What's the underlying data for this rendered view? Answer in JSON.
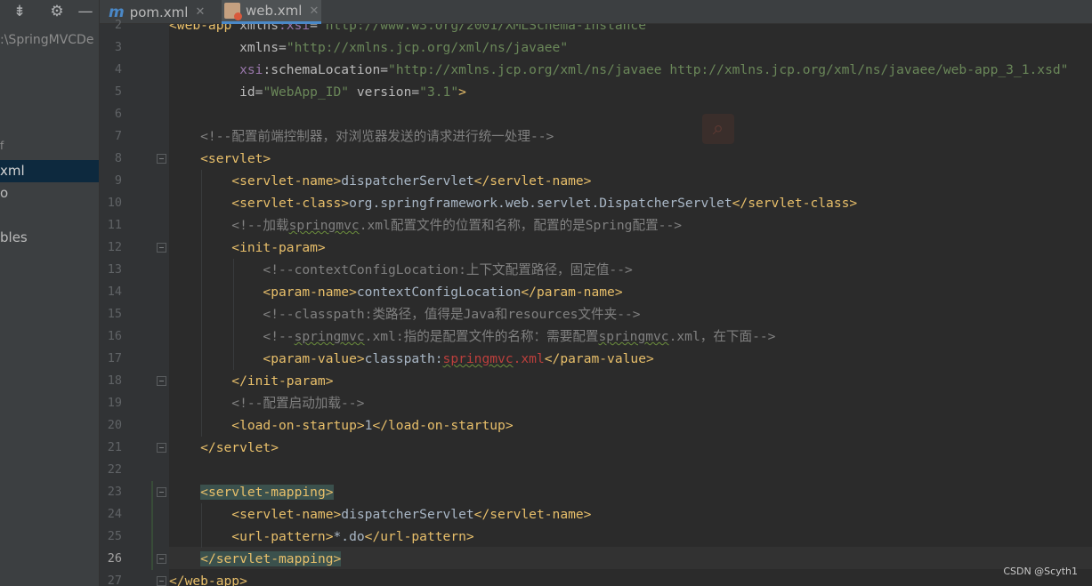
{
  "sidebar": {
    "toolbar_icons": [
      "collapse-all-icon",
      "gear-icon",
      "hide-icon"
    ],
    "items": [
      {
        "label": ":\\SpringMVCDe",
        "selected": false,
        "dim": true
      },
      {
        "label": "",
        "selected": false,
        "dim": false
      },
      {
        "label": "xml",
        "selected": true,
        "dim": false
      },
      {
        "label": "o",
        "selected": false,
        "dim": false
      },
      {
        "label": "bles",
        "selected": false,
        "dim": false
      }
    ],
    "tick_mark": "f"
  },
  "tabs": [
    {
      "icon": "m",
      "label": "pom.xml",
      "close": "✕",
      "active": false
    },
    {
      "icon": "xml",
      "label": "web.xml",
      "close": "✕",
      "active": true
    }
  ],
  "editor": {
    "current_line": "26",
    "line_numbers": [
      "2",
      "3",
      "4",
      "5",
      "6",
      "7",
      "8",
      "9",
      "10",
      "11",
      "12",
      "13",
      "14",
      "15",
      "16",
      "17",
      "18",
      "19",
      "20",
      "21",
      "22",
      "23",
      "24",
      "25",
      "26",
      "27"
    ],
    "lines": [
      [
        [
          "t",
          "<web-app "
        ],
        [
          "a",
          "xmlns"
        ],
        [
          "ns",
          ":xsi"
        ],
        [
          "a",
          "="
        ],
        [
          "v",
          "\"http://www.w3.org/2001/XMLSchema-instance\""
        ]
      ],
      [
        [
          "a",
          "         xmlns"
        ],
        [
          "a",
          "="
        ],
        [
          "v",
          "\"http://xmlns.jcp.org/xml/ns/javaee\""
        ]
      ],
      [
        [
          "ns",
          "         xsi"
        ],
        [
          "a",
          ":schemaLocation="
        ],
        [
          "v",
          "\"http://xmlns.jcp.org/xml/ns/javaee http://xmlns.jcp.org/xml/ns/javaee/web-app_3_1.xsd\""
        ]
      ],
      [
        [
          "a",
          "         id="
        ],
        [
          "v",
          "\"WebApp_ID\""
        ],
        [
          "a",
          " version="
        ],
        [
          "v",
          "\"3.1\""
        ],
        [
          "t",
          ">"
        ]
      ],
      [],
      [
        [
          "c",
          "    <!--配置前端控制器，对浏览器发送的请求进行统一处理-->"
        ]
      ],
      [
        [
          "t",
          "    <servlet>"
        ]
      ],
      [
        [
          "t",
          "        <servlet-name>"
        ],
        [
          "tx",
          "dispatcherServlet"
        ],
        [
          "t",
          "</servlet-name>"
        ]
      ],
      [
        [
          "t",
          "        <servlet-class>"
        ],
        [
          "tx",
          "org.springframework.web.servlet.DispatcherServlet"
        ],
        [
          "t",
          "</servlet-class>"
        ]
      ],
      [
        [
          "c",
          "        <!--加载"
        ],
        [
          "c sq",
          "springmvc"
        ],
        [
          "c",
          ".xml配置文件的位置和名称，配置的是Spring配置-->"
        ]
      ],
      [
        [
          "t",
          "        <init-param>"
        ]
      ],
      [
        [
          "c",
          "            <!--contextConfigLocation:上下文配置路径，固定值-->"
        ]
      ],
      [
        [
          "t",
          "            <param-name>"
        ],
        [
          "tx",
          "contextConfigLocation"
        ],
        [
          "t",
          "</param-name>"
        ]
      ],
      [
        [
          "c",
          "            <!--classpath:类路径，值得是Java和resources文件夹-->"
        ]
      ],
      [
        [
          "c",
          "            <!--"
        ],
        [
          "c sq",
          "springmvc"
        ],
        [
          "c",
          ".xml:指的是配置文件的名称：需要配置"
        ],
        [
          "c sq",
          "springmvc"
        ],
        [
          "c",
          ".xml，在下面-->"
        ]
      ],
      [
        [
          "t",
          "            <param-value>"
        ],
        [
          "tx",
          "classpath:"
        ],
        [
          "err sq",
          "springmvc"
        ],
        [
          "err",
          ".xml"
        ],
        [
          "t",
          "</param-value>"
        ]
      ],
      [
        [
          "t",
          "        </init-param>"
        ]
      ],
      [
        [
          "c",
          "        <!--配置启动加载-->"
        ]
      ],
      [
        [
          "t",
          "        <load-on-startup>"
        ],
        [
          "tx",
          "1"
        ],
        [
          "t",
          "</load-on-startup>"
        ]
      ],
      [
        [
          "t",
          "    </servlet>"
        ]
      ],
      [],
      [
        [
          "tx",
          "    "
        ],
        [
          "t hl",
          "<servlet-mapping>"
        ]
      ],
      [
        [
          "t",
          "        <servlet-name>"
        ],
        [
          "tx",
          "dispatcherServlet"
        ],
        [
          "t",
          "</servlet-name>"
        ]
      ],
      [
        [
          "t",
          "        <url-pattern>"
        ],
        [
          "tx",
          "*.do"
        ],
        [
          "t",
          "</url-pattern>"
        ]
      ],
      [
        [
          "tx",
          "    "
        ],
        [
          "t hl",
          "</servlet-mapping>"
        ]
      ],
      [
        [
          "t",
          "</web-app>"
        ]
      ]
    ]
  },
  "watermark": "CSDN @Scyth1",
  "colors": {
    "tag": "#e8bf6a",
    "attribute": "#bababa",
    "namespace": "#9876aa",
    "string": "#6a8759",
    "comment": "#808080",
    "text": "#a9b7c6",
    "error": "#bc3f3c",
    "tab_accent": "#4a88c7"
  }
}
